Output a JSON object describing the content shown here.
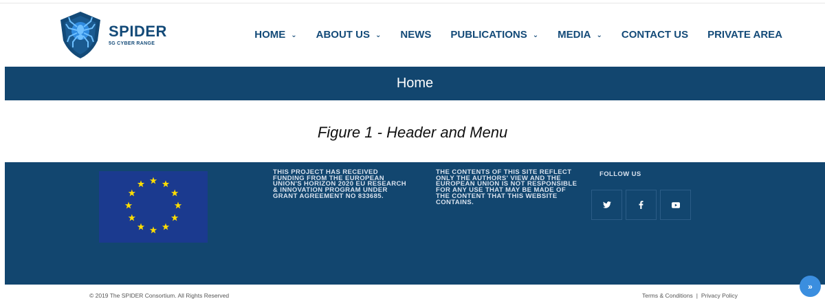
{
  "logo": {
    "title": "SPIDER",
    "subtitle": "5G CYBER RANGE"
  },
  "nav": [
    {
      "label": "HOME",
      "has_menu": true
    },
    {
      "label": "ABOUT US",
      "has_menu": true
    },
    {
      "label": "NEWS",
      "has_menu": false
    },
    {
      "label": "PUBLICATIONS",
      "has_menu": true
    },
    {
      "label": "MEDIA",
      "has_menu": true
    },
    {
      "label": "CONTACT US",
      "has_menu": false
    },
    {
      "label": "PRIVATE AREA",
      "has_menu": false
    }
  ],
  "banner": {
    "title": "Home"
  },
  "caption": "Figure 1 - Header and Menu",
  "footer": {
    "funding_text": "THIS PROJECT HAS RECEIVED FUNDING FROM THE EUROPEAN UNION'S HORIZON 2020 EU RESEARCH & INNOVATION PROGRAM UNDER GRANT AGREEMENT NO 833685.",
    "disclaimer_text": "THE CONTENTS OF THIS SITE REFLECT ONLY THE AUTHORS' VIEW AND THE EUROPEAN UNION IS NOT RESPONSIBLE FOR ANY USE THAT MAY BE MADE OF THE CONTENT THAT THIS WEBSITE CONTAINS.",
    "follow_label": "FOLLOW US",
    "socials": [
      {
        "icon": "twitter-icon"
      },
      {
        "icon": "facebook-icon"
      },
      {
        "icon": "youtube-icon"
      }
    ]
  },
  "bottom": {
    "copyright": "© 2019 The SPIDER Consortium. All Rights Reserved",
    "terms": "Terms & Conditions",
    "separator": "|",
    "privacy": "Privacy Policy"
  },
  "colors": {
    "primary": "#12466f",
    "accent": "#3b8edf",
    "eu_blue": "#1b3a8f",
    "eu_star": "#ffdd00"
  }
}
